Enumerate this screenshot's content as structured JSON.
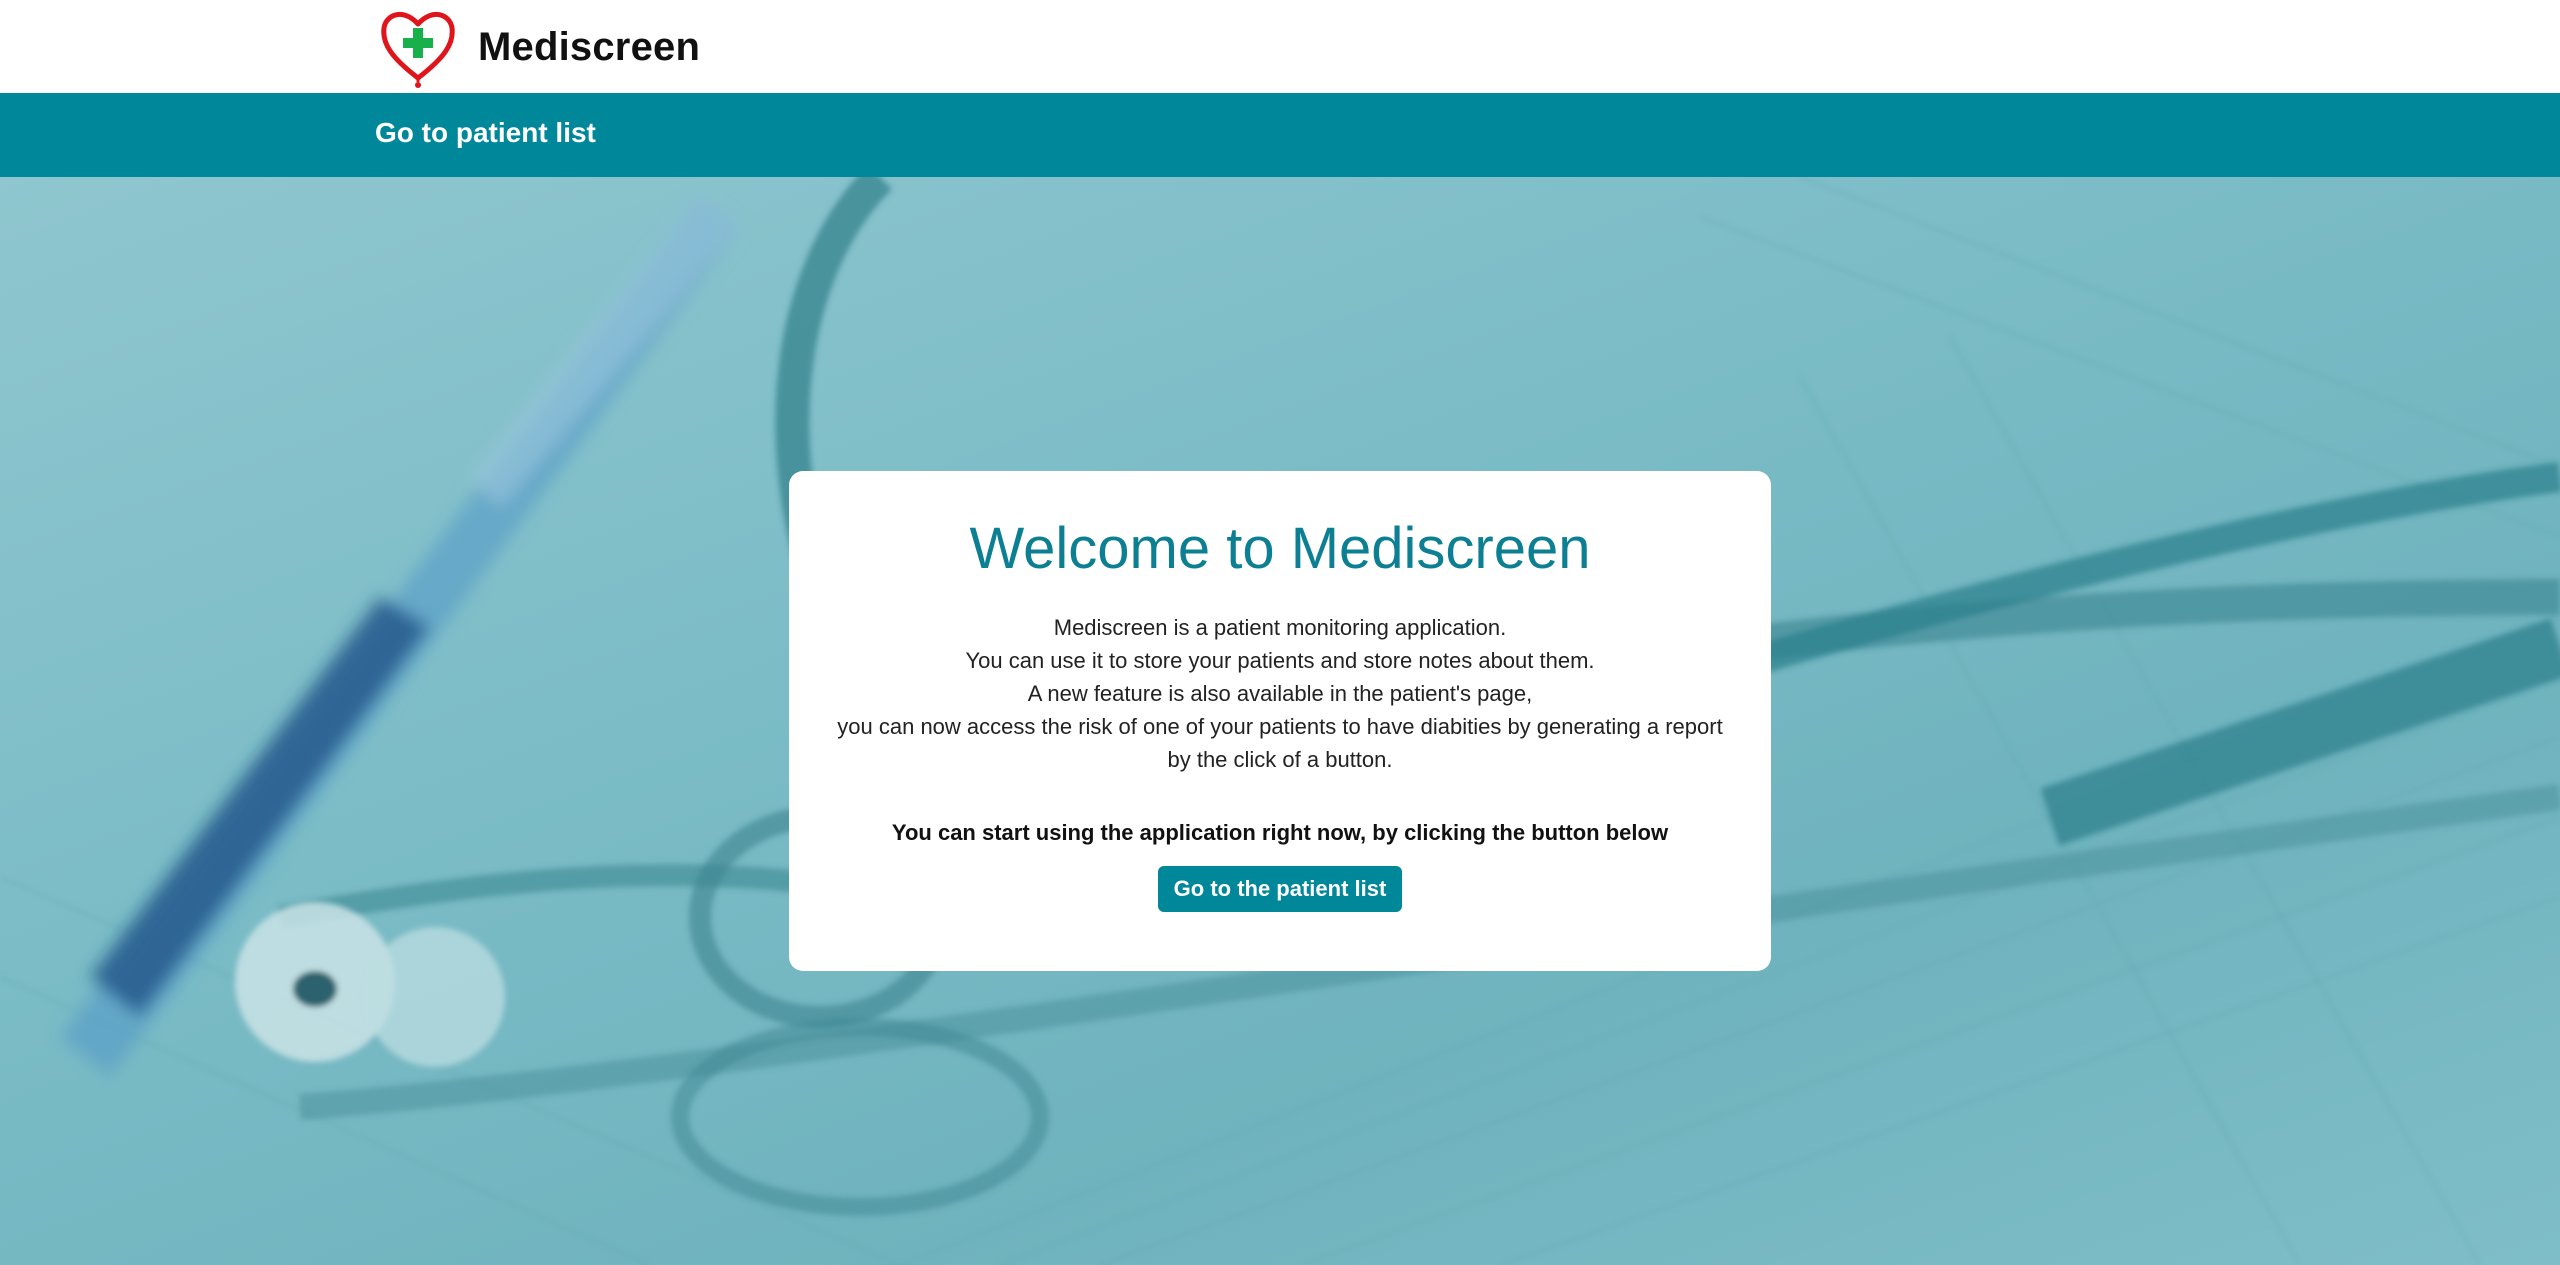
{
  "header": {
    "brand_name": "Mediscreen",
    "logo_icon": "heart-cross-icon"
  },
  "navbar": {
    "link_label": "Go to patient list"
  },
  "welcome_card": {
    "title": "Welcome to Mediscreen",
    "description_lines": [
      "Mediscreen is a patient monitoring application.",
      "You can use it to store your patients and store notes about them.",
      "A new feature is also available in the patient's page,",
      "you can now access the risk of one of your patients to have diabities by generating a report",
      "by the click of a button."
    ],
    "cta_text": "You can start using the application right now, by clicking the button below",
    "button_label": "Go to the patient list"
  },
  "colors": {
    "accent": "#00879a",
    "title": "#0c7f93",
    "logo_heart": "#e0141b",
    "logo_cross": "#18b04a"
  }
}
